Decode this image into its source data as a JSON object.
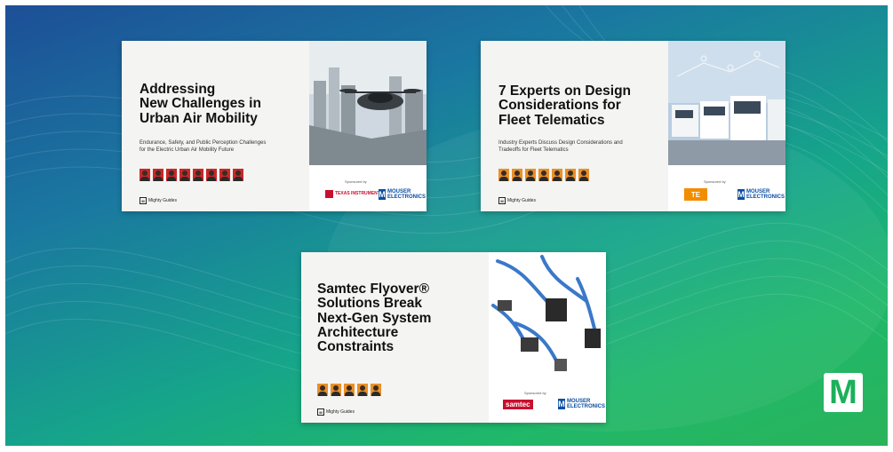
{
  "cards": [
    {
      "title_lines": [
        "Addressing",
        "New Challenges in",
        "Urban Air Mobility"
      ],
      "subtitle_lines": [
        "Endurance, Safety, and Public Perception Challenges",
        "for the Electric Urban Air Mobility Future"
      ],
      "brand": "Mighty Guides",
      "sponsored_by": "Sponsored by",
      "sponsor_logos": [
        "TEXAS INSTRUMENTS",
        "MOUSER ELECTRONICS"
      ],
      "face_color": "#c8282a",
      "face_count": 8
    },
    {
      "title_lines": [
        "7 Experts on Design",
        "Considerations for",
        "Fleet Telematics"
      ],
      "subtitle_lines": [
        "Industry Experts Discuss Design Considerations and",
        "Tradeoffs for Fleet Telematics"
      ],
      "brand": "Mighty Guides",
      "sponsored_by": "Sponsored by",
      "sponsor_logos": [
        "TE",
        "MOUSER ELECTRONICS"
      ],
      "face_color": "#e8902a",
      "face_count": 7
    },
    {
      "title_lines": [
        "Samtec Flyover®",
        "Solutions Break",
        "Next-Gen System",
        "Architecture",
        "Constraints"
      ],
      "subtitle_lines": [],
      "brand": "Mighty Guides",
      "sponsored_by": "Sponsored by",
      "sponsor_logos": [
        "samtec",
        "MOUSER ELECTRONICS"
      ],
      "face_color": "#e8902a",
      "face_count": 5
    }
  ],
  "corner_logo": "M",
  "colors": {
    "mouser_blue": "#0b4ea2",
    "mouser_green": "#1bb05a",
    "ti_red": "#c8102e",
    "te_orange": "#f28c00"
  }
}
